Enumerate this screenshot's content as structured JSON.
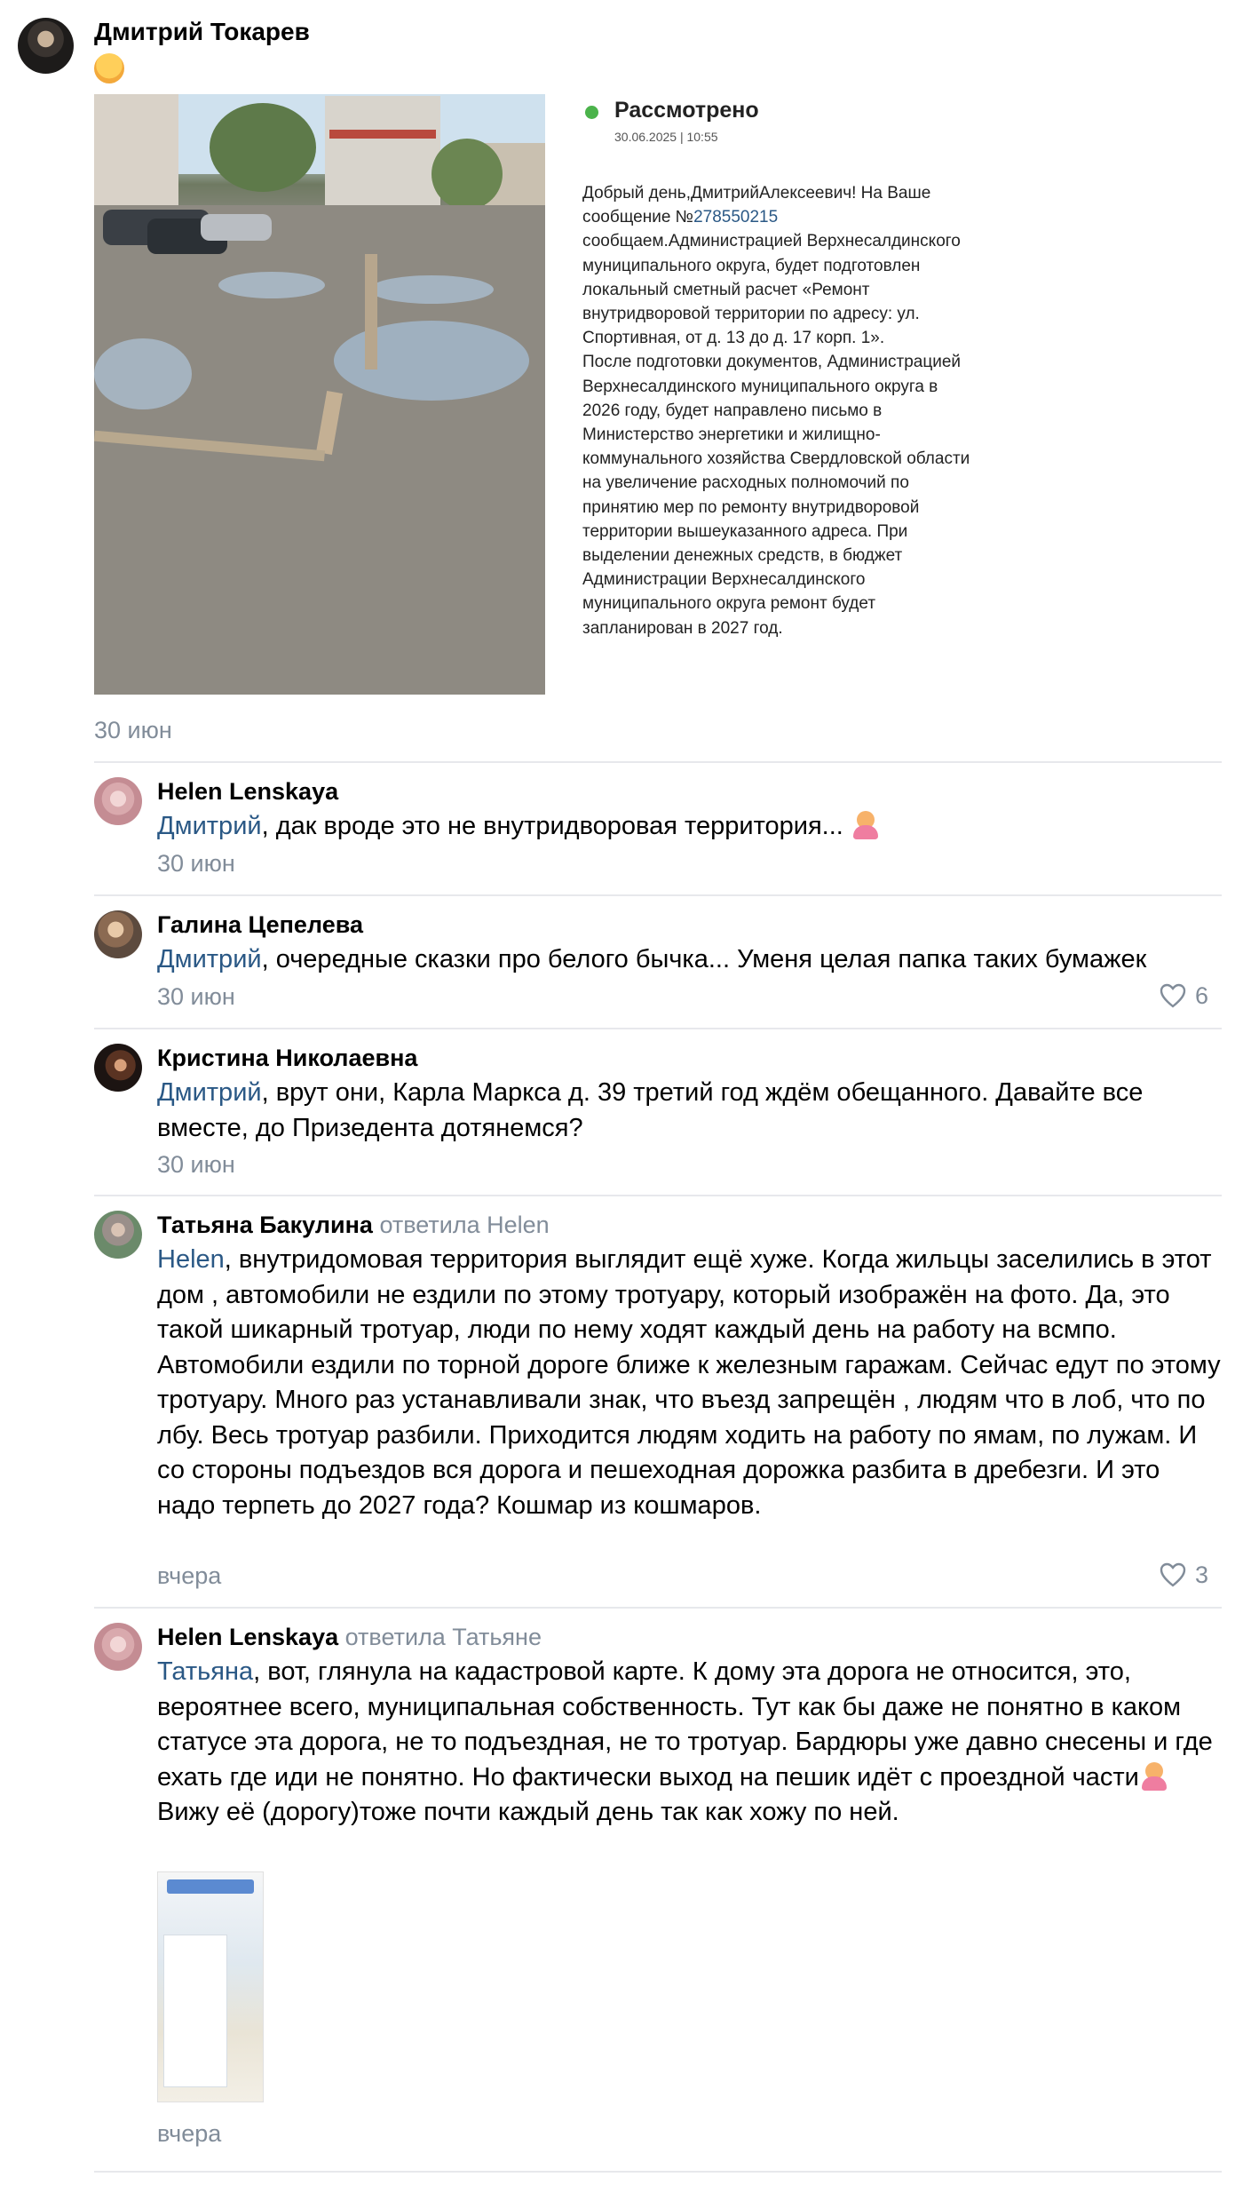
{
  "post": {
    "author": "Дмитрий Токарев",
    "reaction_icon": "monocle-face-emoji",
    "date": "30 июн",
    "document": {
      "status": "Рассмотрено",
      "datetime": "30.06.2025 | 10:55",
      "text_before_link": "Добрый день,ДмитрийАлексеевич! На Ваше сообщение №",
      "link": "278550215",
      "text_after_link": "\nсообщаем.Администрацией Верхнесалдинского муниципального округа, будет подготовлен локальный сметный расчет «Ремонт внутридворовой территории по адресу: ул. Спортивная, от д. 13 до д. 17 корп. 1».\nПосле подготовки документов, Администрацией Верхнесалдинского муниципального округа в 2026 году, будет направлено письмо в Министерство энергетики и жилищно-коммунального хозяйства Свердловской области на увеличение расходных полномочий по принятию мер по ремонту внутридворовой территории вышеуказанного адреса. При выделении денежных средств, в бюджет Администрации Верхнесалдинского муниципального округа ремонт будет запланирован в 2027 год."
    }
  },
  "comments": [
    {
      "author": "Helen Lenskaya",
      "mention": "Дмитрий",
      "text": ", дак вроде это не внутридворовая территория... ",
      "emoji": "person-tipping-hand-emoji",
      "date": "30 июн"
    },
    {
      "author": "Галина Цепелева",
      "mention": "Дмитрий",
      "text": ", очередные сказки про белого бычка... Уменя целая папка таких бумажек",
      "date": "30 июн",
      "likes": "6"
    },
    {
      "author": "Кристина Николаевна",
      "mention": "Дмитрий",
      "text": ", врут они, Карла Маркса д. 39 третий год ждём обещанного. Давайте все вместе, до Призедента дотянемся?",
      "date": "30 июн"
    },
    {
      "author": "Татьяна Бакулина",
      "reply_to": "ответила Helen",
      "mention": "Helen",
      "text": ", внутридомовая территория выглядит ещё хуже. Когда жильцы заселились в этот дом , автомобили не ездили по этому тротуару, который изображён на фото. Да, это такой шикарный тротуар, люди по нему ходят каждый день на работу на всмпо. Автомобили ездили по торной дороге ближе к железным гаражам. Сейчас едут по этому тротуару. Много раз устанавливали знак, что въезд запрещён , людям что в лоб, что по лбу. Весь тротуар разбили. Приходится людям ходить на работу по ямам, по лужам. И со стороны подъездов вся дорога и пешеходная дорожка разбита в дребезги. И это надо терпеть до 2027 года? Кошмар из кошмаров.",
      "date": "вчера",
      "likes": "3"
    },
    {
      "author": "Helen Lenskaya",
      "reply_to": "ответила Татьяне",
      "mention": "Татьяна",
      "text": ", вот, глянула на кадастровой карте. К дому эта дорога не относится, это, вероятнее всего, муниципальная собственность. Тут как бы даже не понятно в каком статусе эта дорога, не то подъездная, не то тротуар. Бардюры уже давно снесены и где ехать где иди не понятно. Но фактически выход на пешик идёт с проездной части",
      "emoji": "person-tipping-hand-emoji",
      "text2": "Вижу её (дорогу)тоже почти каждый день так как хожу по ней.",
      "date": "вчера"
    }
  ]
}
